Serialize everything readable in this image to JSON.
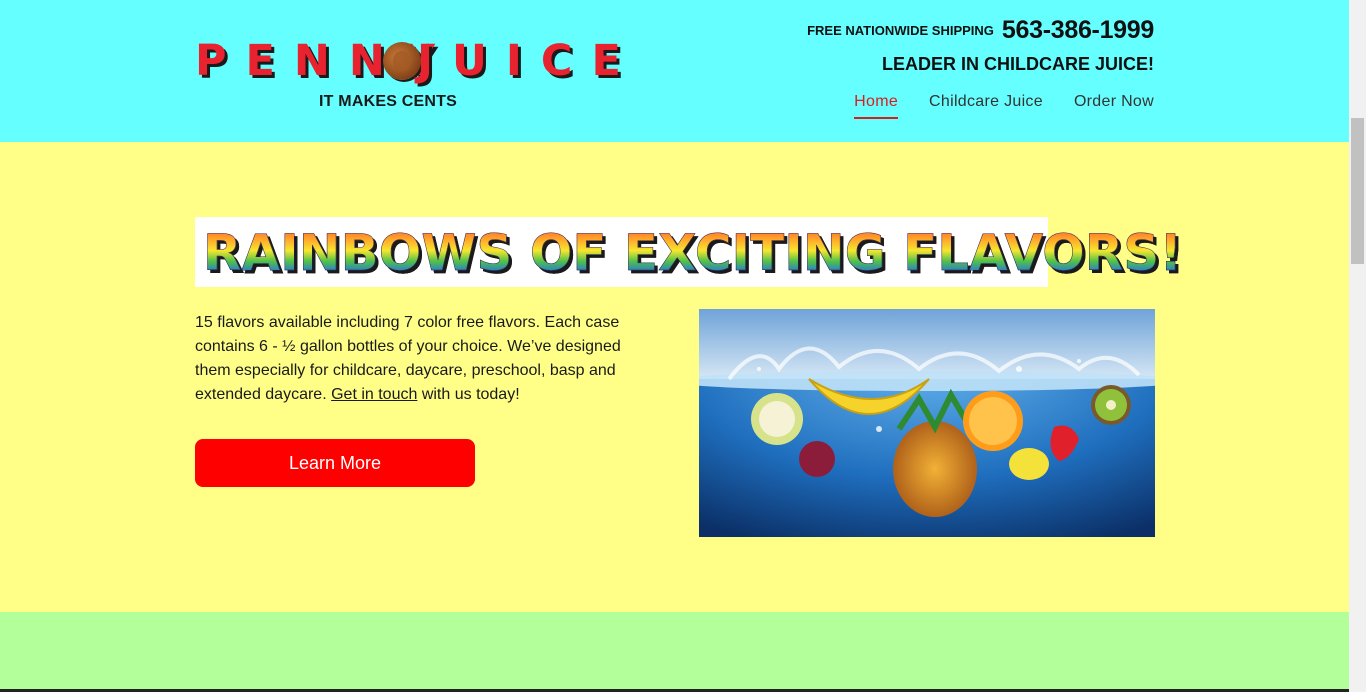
{
  "header": {
    "logo": {
      "left_word": "PENNY",
      "right_word": "JUICE",
      "alt": "Penny Juice"
    },
    "tagline": "IT MAKES CENTS",
    "shipping_label": "FREE NATIONWIDE SHIPPING",
    "phone": "563-386-1999",
    "leader": "LEADER IN CHILDCARE JUICE!",
    "nav": [
      {
        "label": "Home",
        "active": true
      },
      {
        "label": "Childcare Juice",
        "active": false
      },
      {
        "label": "Order Now",
        "active": false
      }
    ]
  },
  "hero": {
    "banner_text": "RAINBOWS OF EXCITING FLAVORS!",
    "paragraph_before_link": "15 flavors available including 7 color free flavors. Each case contains 6 - ½ gallon bottles of your choice. We’ve designed them especially for childcare, daycare, preschool, basp and extended daycare. ",
    "link_text": "Get in touch",
    "paragraph_after_link": " with us today!",
    "cta_label": "Learn More",
    "image_alt": "Fruit splashing into water"
  },
  "colors": {
    "header_bg": "#66ffff",
    "hero_bg": "#ffff88",
    "green_bg": "#b3ff99",
    "accent_red": "#ff0000",
    "nav_active": "#d81d1d"
  }
}
